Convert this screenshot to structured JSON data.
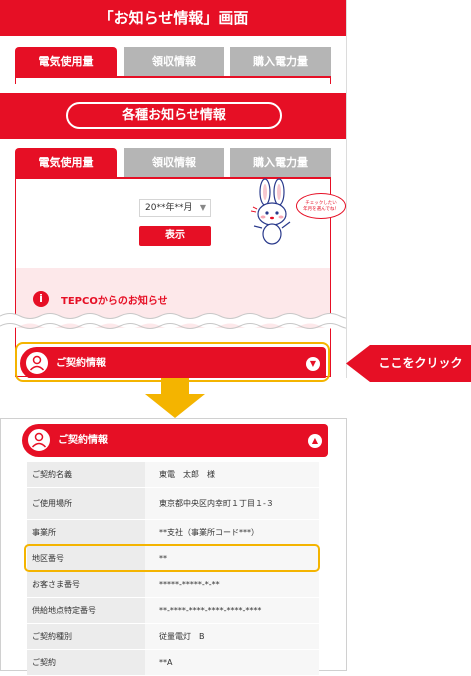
{
  "top_screen": {
    "title": "「お知らせ情報」画面",
    "tabs_top": [
      "電気使用量",
      "領収情報",
      "購入電力量"
    ],
    "banner_title": "各種お知らせ情報",
    "tabs_main": [
      "電気使用量",
      "領収情報",
      "購入電力量"
    ],
    "mascot_bubble": "チェックしたい\n年月を選んでね！",
    "month_select": "20**年**月",
    "show_button": "表示",
    "tepco_notice": "TEPCOからのお知らせ",
    "contract_header": "ご契約情報"
  },
  "callout": {
    "label": "ここをクリック"
  },
  "bottom_screen": {
    "contract_header": "ご契約情報",
    "rows": [
      {
        "label": "ご契約名義",
        "value": "東電　太郎　様"
      },
      {
        "label": "ご使用場所",
        "value": "東京都中央区内幸町１丁目１-３"
      },
      {
        "label": "事業所",
        "value": "**支社（事業所コード***）"
      },
      {
        "label": "地区番号",
        "value": "**"
      },
      {
        "label": "お客さま番号",
        "value": "*****-*****-*-**"
      },
      {
        "label": "供給地点特定番号",
        "value": "**-****-****-****-****-****"
      },
      {
        "label": "ご契約種別",
        "value": "従量電灯　B"
      },
      {
        "label": "ご契約",
        "value": "**A"
      }
    ]
  },
  "colors": {
    "primary": "#e60f25",
    "highlight": "#f4b400",
    "inactive_tab": "#b5b5b5"
  }
}
